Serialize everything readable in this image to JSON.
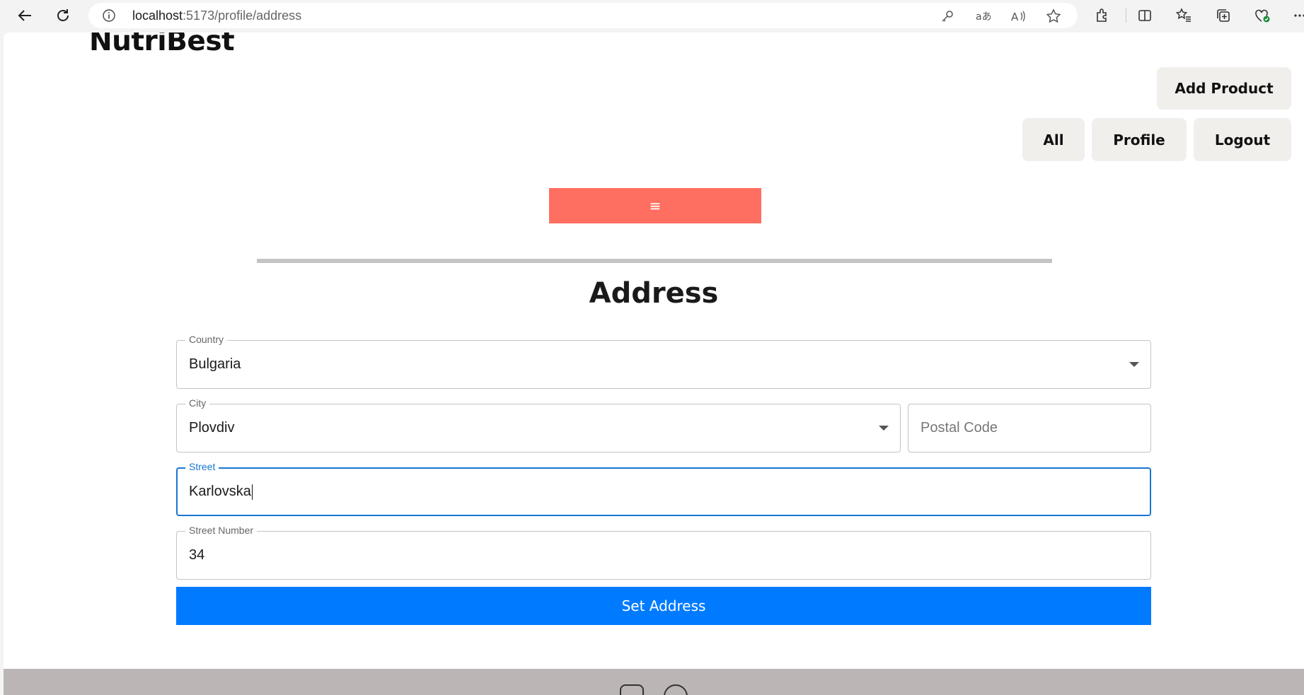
{
  "browser": {
    "url_host": "localhost",
    "url_path": ":5173/profile/address"
  },
  "header": {
    "brand": "NutriBest",
    "add_product": "Add Product",
    "nav": [
      "All",
      "Profile",
      "Logout"
    ],
    "menu_toggle": "≡"
  },
  "main": {
    "title": "Address",
    "country": {
      "label": "Country",
      "value": "Bulgaria"
    },
    "city": {
      "label": "City",
      "value": "Plovdiv"
    },
    "postal_code": {
      "placeholder": "Postal Code",
      "value": ""
    },
    "street": {
      "label": "Street",
      "value": "Karlovska"
    },
    "street_number": {
      "label": "Street Number",
      "value": "34"
    },
    "submit_label": "Set Address"
  },
  "colors": {
    "menu_toggle": "#ff6f61",
    "submit": "#007bff",
    "focus": "#1976d2",
    "footer": "#bcb5b5"
  }
}
